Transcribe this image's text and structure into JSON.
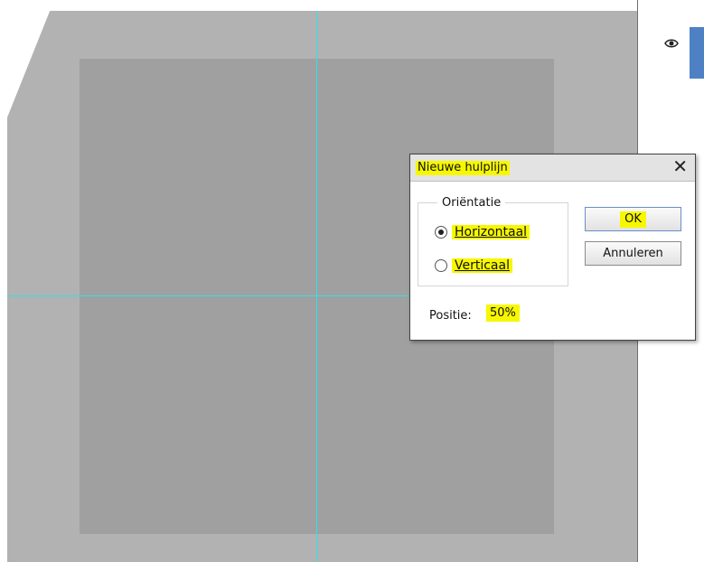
{
  "dialog": {
    "title": "Nieuwe hulplijn",
    "orientation_label": "Oriëntatie",
    "horizontal_label": "Horizontaal",
    "vertical_label": "Verticaal",
    "position_label": "Positie:",
    "position_value": "50%",
    "ok_label": "OK",
    "cancel_label": "Annuleren",
    "selected_orientation": "Horizontaal"
  },
  "colors": {
    "highlight": "#f7f700",
    "guide": "#33e0e8",
    "workspace": "#b2b2b2",
    "document": "#a0a0a0",
    "layer_thumb": "#4e81c4"
  },
  "icons": {
    "close": "close-icon",
    "layer_visibility": "eye-icon"
  }
}
